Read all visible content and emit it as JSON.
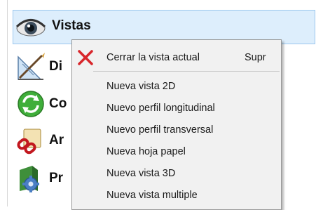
{
  "panel": {
    "items": [
      {
        "label": "Vistas",
        "icon": "eye-icon"
      },
      {
        "label": "Di",
        "icon": "drawing-tools-icon"
      },
      {
        "label": "Co",
        "icon": "refresh-arrows-icon"
      },
      {
        "label": "Ar",
        "icon": "chain-link-icon"
      },
      {
        "label": "Pr",
        "icon": "gear-package-icon"
      }
    ]
  },
  "context_menu": {
    "items": [
      {
        "label": "Cerrar la vista actual",
        "shortcut": "Supr",
        "icon": "close-x-icon"
      },
      {
        "label": "Nueva vista 2D"
      },
      {
        "label": "Nuevo perfil longitudinal"
      },
      {
        "label": "Nuevo perfil transversal"
      },
      {
        "label": "Nueva hoja papel"
      },
      {
        "label": "Nueva vista 3D"
      },
      {
        "label": "Nueva vista multiple"
      }
    ]
  },
  "colors": {
    "selected_row_bg": "#ddeefc",
    "selected_row_border": "#9cc7ee",
    "menu_bg": "#f1f1f1",
    "close_icon_red": "#d8262b"
  }
}
